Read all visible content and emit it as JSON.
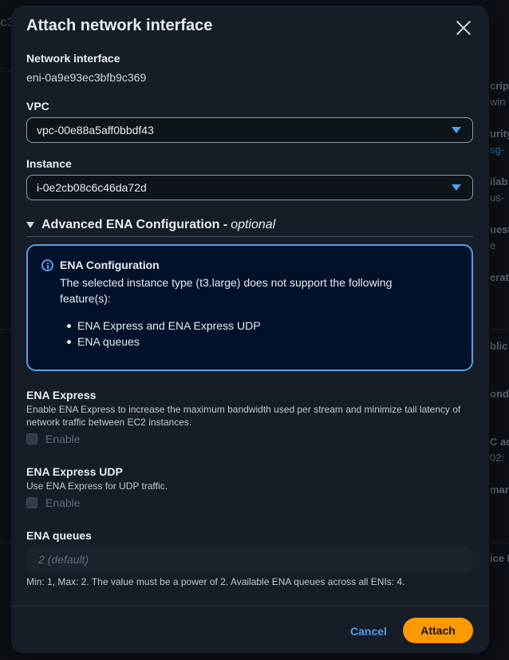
{
  "background": {
    "left_fragment": "c3",
    "right_fragments": [
      {
        "text": "cript",
        "style": "bold"
      },
      {
        "text": "win",
        "style": "light"
      },
      {
        "text": "urity",
        "style": "bold"
      },
      {
        "text": "sg-",
        "style": "link"
      },
      {
        "text": "ilab",
        "style": "bold"
      },
      {
        "text": "us-",
        "style": "light"
      },
      {
        "text": "uest",
        "style": "bold"
      },
      {
        "text": "e",
        "style": "light"
      },
      {
        "text": "erat",
        "style": "bold"
      },
      {
        "text": "blic I",
        "style": "bold"
      },
      {
        "text": "onda",
        "style": "bold"
      },
      {
        "text": "C ad",
        "style": "bold"
      },
      {
        "text": "02:",
        "style": "light"
      },
      {
        "text": "mary",
        "style": "bold"
      },
      {
        "text": "ice I",
        "style": "bold"
      }
    ]
  },
  "modal": {
    "title": "Attach network interface",
    "network_interface": {
      "label": "Network interface",
      "value": "eni-0a9e93ec3bfb9c369"
    },
    "vpc": {
      "label": "VPC",
      "value": "vpc-00e88a5aff0bbdf43"
    },
    "instance": {
      "label": "Instance",
      "value": "i-0e2cb08c6c46da72d"
    },
    "advanced": {
      "title": "Advanced ENA Configuration -",
      "optional": "optional"
    },
    "alert": {
      "title": "ENA Configuration",
      "body": "The selected instance type (t3.large) does not support the following feature(s):",
      "items": [
        "ENA Express and ENA Express UDP",
        "ENA queues"
      ]
    },
    "ena_express": {
      "label": "ENA Express",
      "description": "Enable ENA Express to increase the maximum bandwidth used per stream and minimize tail latency of network traffic between EC2 instances.",
      "checkbox_label": "Enable"
    },
    "ena_express_udp": {
      "label": "ENA Express UDP",
      "description": "Use ENA Express for UDP traffic.",
      "checkbox_label": "Enable"
    },
    "ena_queues": {
      "label": "ENA queues",
      "placeholder": "2 (default)",
      "constraint": "Min: 1, Max: 2. The value must be a power of 2. Available ENA queues across all ENIs: 4."
    },
    "footer": {
      "cancel_label": "Cancel",
      "attach_label": "Attach"
    }
  },
  "colors": {
    "accent_blue": "#539fe5",
    "primary_orange": "#ff9900",
    "modal_bg": "#161d26"
  }
}
